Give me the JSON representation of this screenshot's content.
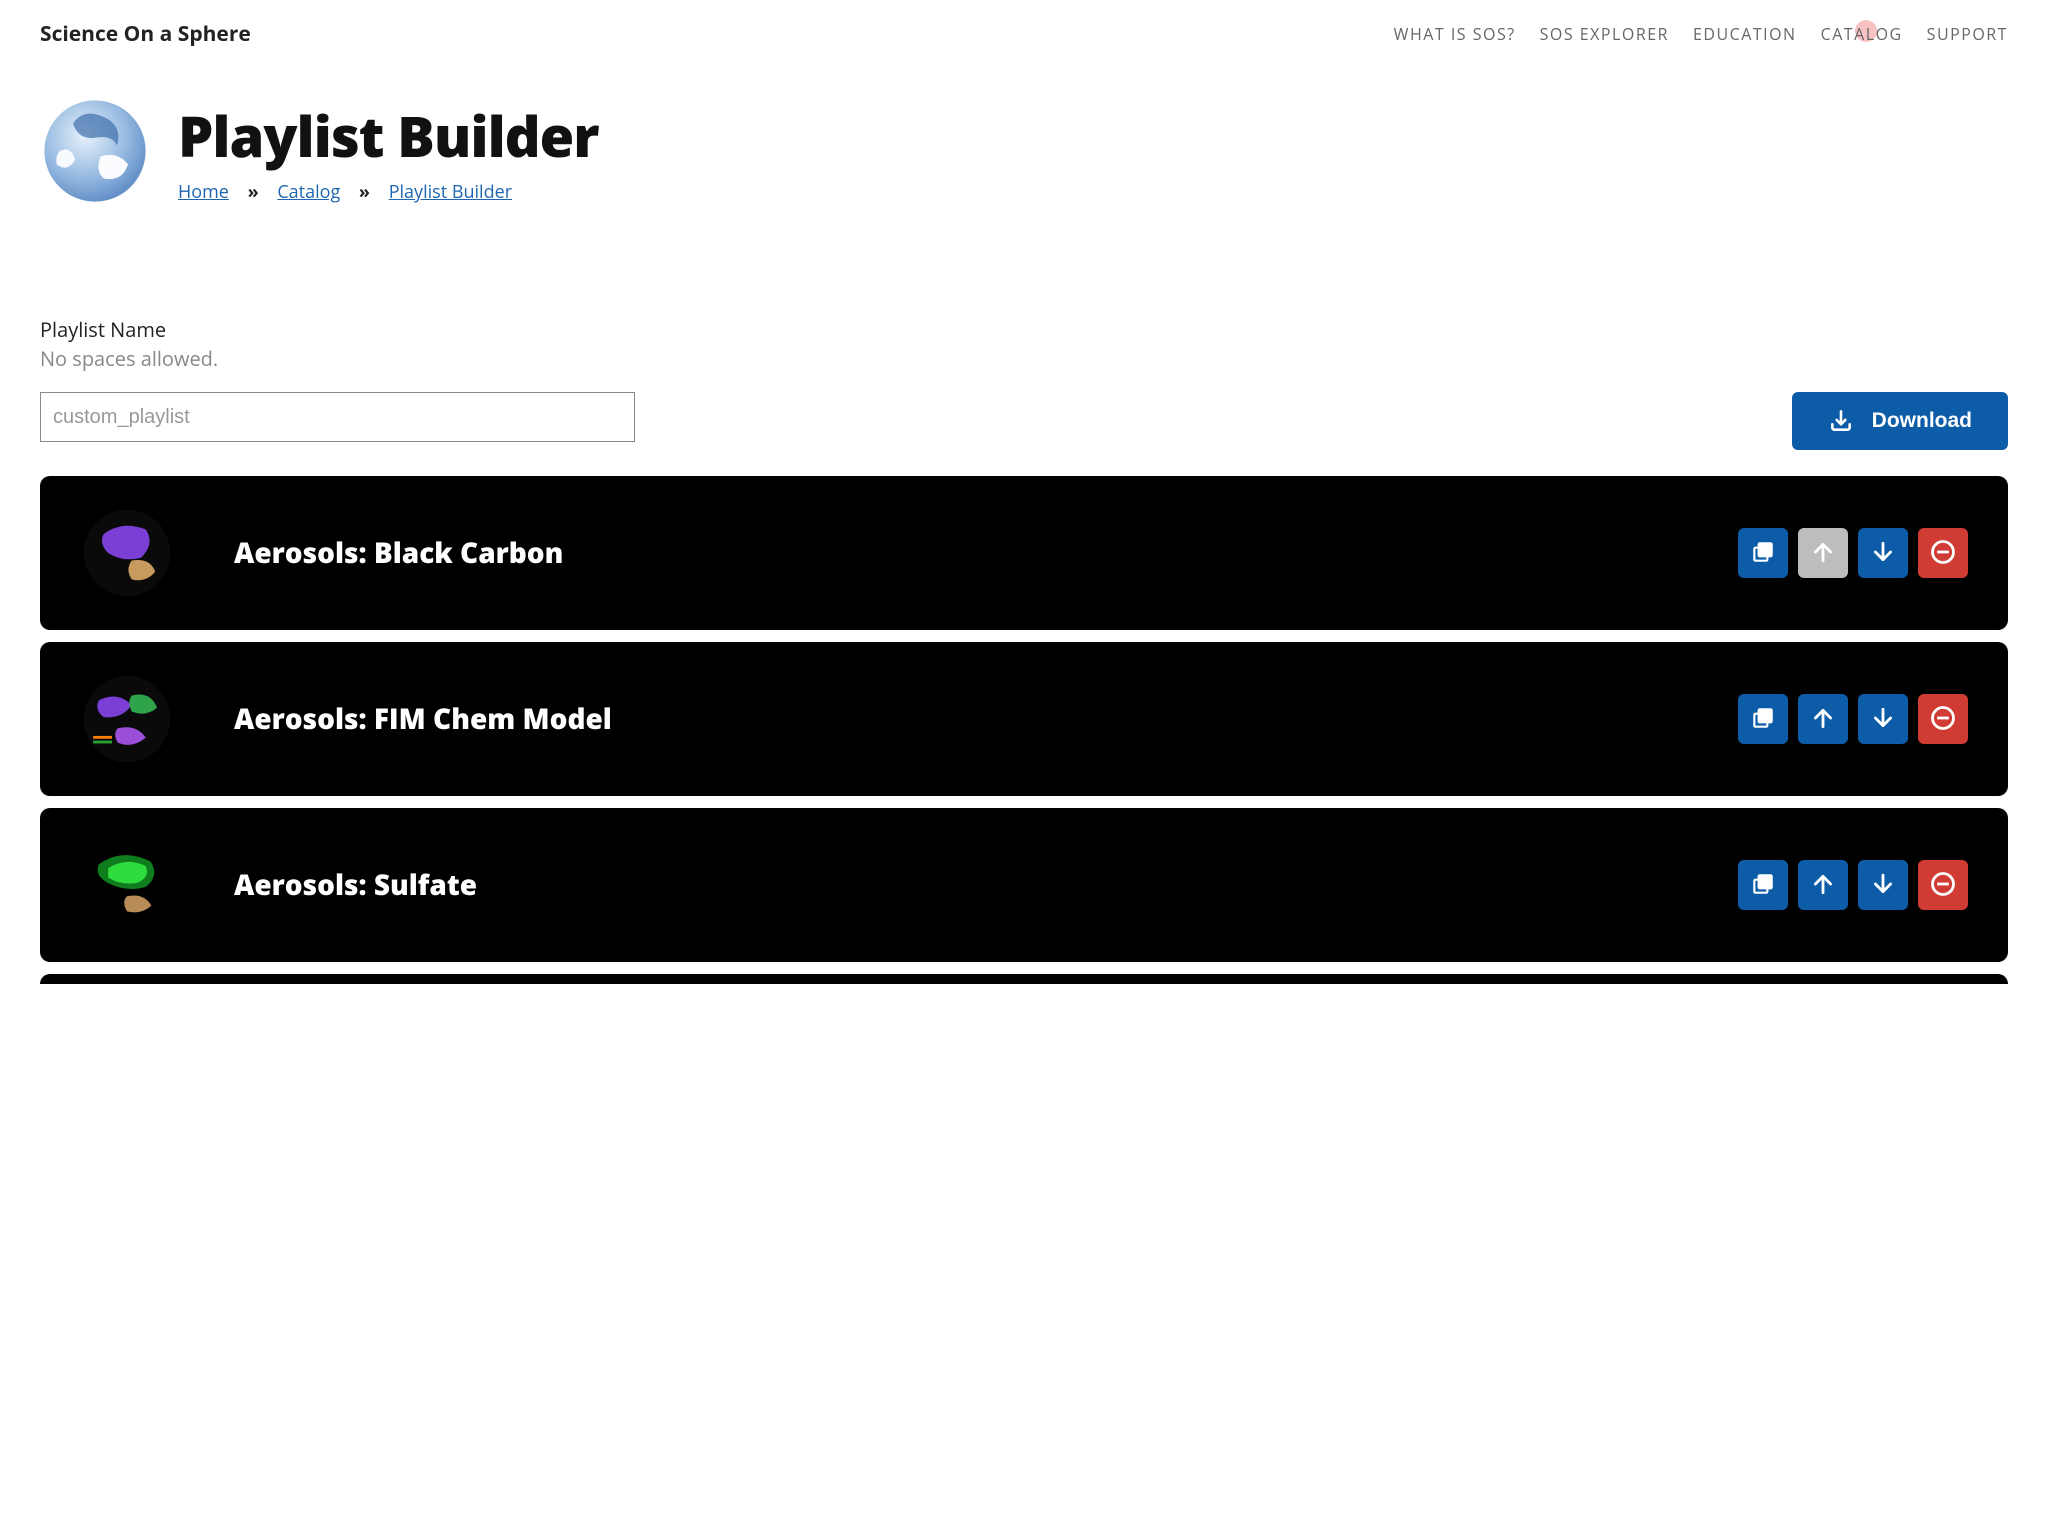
{
  "brand": "Science On a Sphere",
  "nav": {
    "whatIsSos": "WHAT IS SOS?",
    "sosExplorer": "SOS EXPLORER",
    "education": "EDUCATION",
    "catalog": "CATALOG",
    "support": "SUPPORT"
  },
  "page": {
    "title": "Playlist Builder",
    "breadcrumb": {
      "home": "Home",
      "catalog": "Catalog",
      "current": "Playlist Builder"
    }
  },
  "form": {
    "label": "Playlist Name",
    "hint": "No spaces allowed.",
    "placeholder": "custom_playlist",
    "downloadLabel": "Download"
  },
  "items": [
    {
      "title": "Aerosols: Black Carbon",
      "upDisabled": true
    },
    {
      "title": "Aerosols: FIM Chem Model",
      "upDisabled": false
    },
    {
      "title": "Aerosols: Sulfate",
      "upDisabled": false
    }
  ]
}
